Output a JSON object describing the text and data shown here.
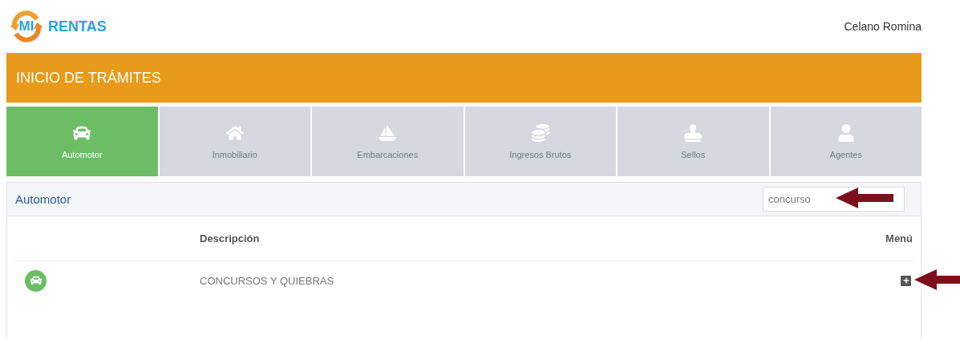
{
  "logo": {
    "mark": "MI",
    "name": "RENTAS"
  },
  "user": "Celano Romina",
  "title": "INICIO DE TRÁMITES",
  "tabs": [
    {
      "label": "Automotor",
      "selected": true
    },
    {
      "label": "Inmobiliario",
      "selected": false
    },
    {
      "label": "Embarcaciones",
      "selected": false
    },
    {
      "label": "Ingresos Brutos",
      "selected": false
    },
    {
      "label": "Sellos",
      "selected": false
    },
    {
      "label": "Agentes",
      "selected": false
    }
  ],
  "panel": {
    "title": "Automotor",
    "search": {
      "value": "concurso"
    }
  },
  "table": {
    "columns": [
      "Descripción",
      "Menú"
    ],
    "rows": [
      {
        "description": "CONCURSOS Y QUIEBRAS"
      }
    ]
  }
}
